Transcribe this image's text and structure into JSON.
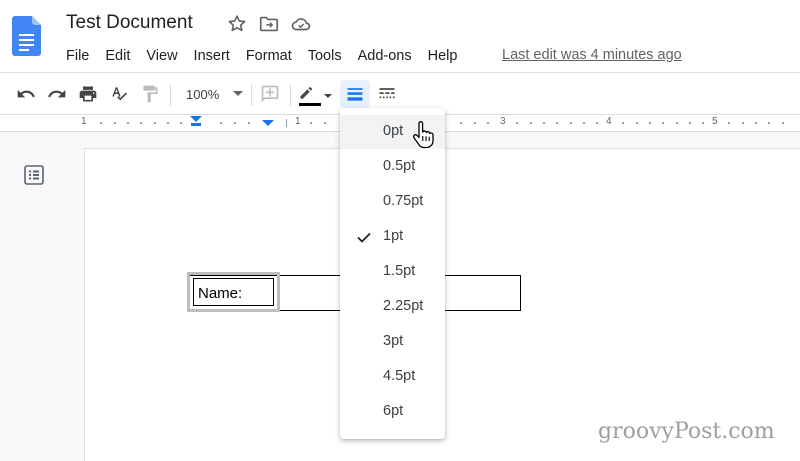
{
  "document": {
    "title": "Test Document",
    "last_edit": "Last edit was 4 minutes ago"
  },
  "menu": [
    "File",
    "Edit",
    "View",
    "Insert",
    "Format",
    "Tools",
    "Add-ons",
    "Help"
  ],
  "toolbar": {
    "zoom": "100%"
  },
  "ruler": {
    "labels": [
      "1",
      "1",
      "2",
      "3",
      "4",
      "5"
    ]
  },
  "table": {
    "cell_text": "Name:"
  },
  "border_width_menu": {
    "options": [
      "0pt",
      "0.5pt",
      "0.75pt",
      "1pt",
      "1.5pt",
      "2.25pt",
      "3pt",
      "4.5pt",
      "6pt"
    ],
    "selected": "1pt",
    "hovered": "0pt"
  },
  "watermark": "groovyPost.com",
  "colors": {
    "docs_blue": "#4285f4",
    "accent_active": "#1a73e8",
    "selected_bg": "#e8f0fe"
  }
}
